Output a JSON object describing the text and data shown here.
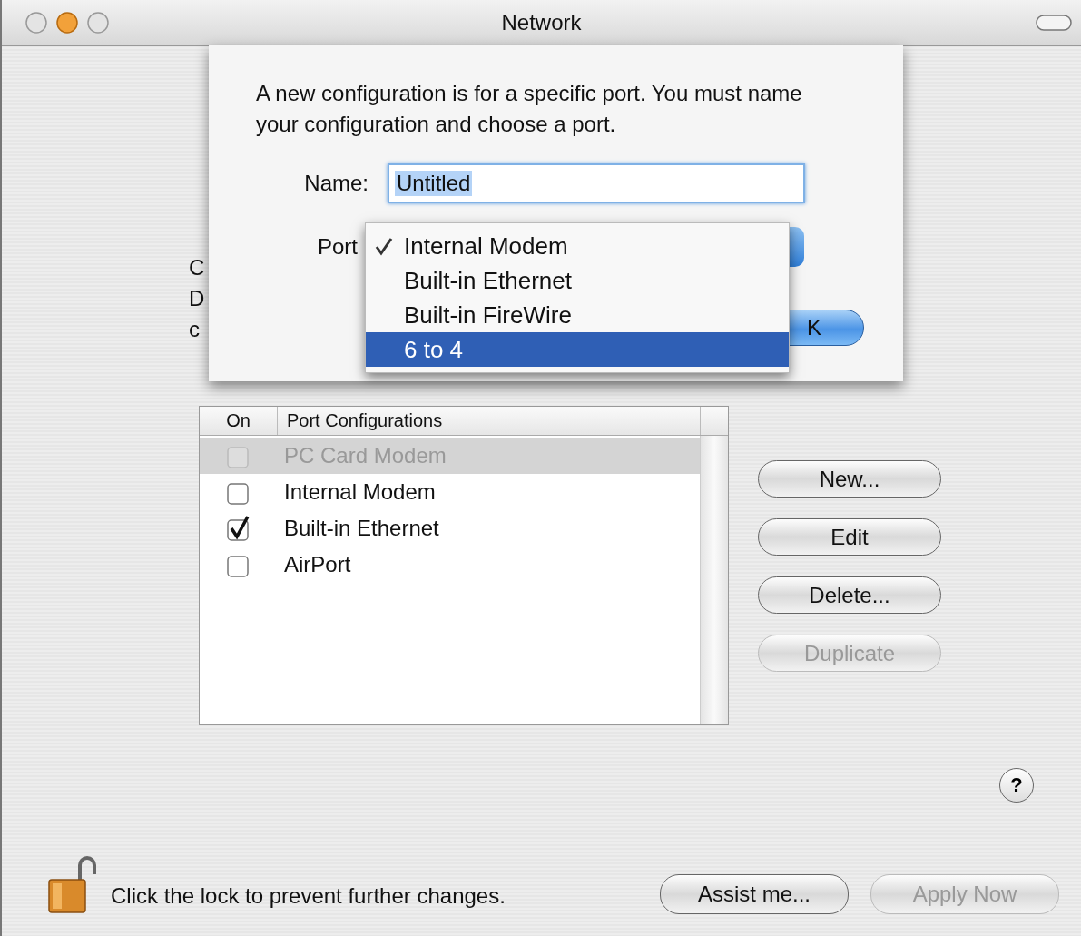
{
  "window": {
    "title": "Network"
  },
  "background_fragments": [
    "C",
    "D",
    "c"
  ],
  "sheet": {
    "message": "A new configuration is for a specific port. You must name your configuration and choose a port.",
    "name_label": "Name:",
    "name_value": "Untitled",
    "name_selected": true,
    "port_label": "Port",
    "port_menu": [
      {
        "label": "Internal Modem",
        "checked": true,
        "selected": false
      },
      {
        "label": "Built-in Ethernet",
        "checked": false,
        "selected": false
      },
      {
        "label": "Built-in FireWire",
        "checked": false,
        "selected": false
      },
      {
        "label": "6 to 4",
        "checked": false,
        "selected": true
      }
    ],
    "ok_button": "K"
  },
  "table": {
    "columns": [
      "On",
      "Port Configurations"
    ],
    "rows": [
      {
        "on": false,
        "label": "PC Card Modem",
        "disabled": true,
        "selected": true
      },
      {
        "on": false,
        "label": "Internal Modem",
        "disabled": false,
        "selected": false
      },
      {
        "on": true,
        "label": "Built-in Ethernet",
        "disabled": false,
        "selected": false
      },
      {
        "on": false,
        "label": "AirPort",
        "disabled": false,
        "selected": false
      }
    ]
  },
  "buttons": [
    {
      "label": "New...",
      "disabled": false
    },
    {
      "label": "Edit",
      "disabled": false
    },
    {
      "label": "Delete...",
      "disabled": false
    },
    {
      "label": "Duplicate",
      "disabled": true
    }
  ],
  "help_button": "?",
  "lock_text": "Click the lock to prevent further changes.",
  "footer_buttons": [
    {
      "label": "Assist me...",
      "disabled": false
    },
    {
      "label": "Apply Now",
      "disabled": true
    }
  ]
}
